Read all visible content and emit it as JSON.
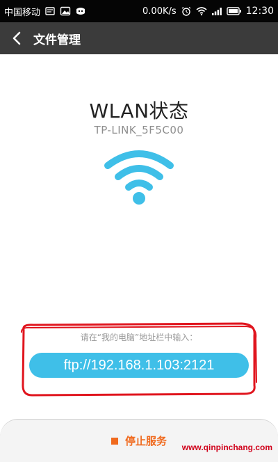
{
  "status_bar": {
    "carrier": "中国移动",
    "speed": "0.00K/s",
    "time": "12:30"
  },
  "header": {
    "title": "文件管理"
  },
  "main": {
    "wlan_title": "WLAN状态",
    "ssid": "TP-LINK_5F5C00",
    "hint": "请在“我的电脑”地址栏中输入：",
    "ftp_address": "ftp://192.168.1.103:2121"
  },
  "footer": {
    "stop_label": "停止服务"
  },
  "watermark": "www.qinpinchang.com",
  "colors": {
    "accent_blue": "#3fbfe8",
    "stop_orange": "#f06a1e",
    "header_bg": "#3b3b3b",
    "annotation_red": "#e0151e"
  },
  "icons": {
    "back": "chevron-left-icon",
    "wifi": "wifi-icon"
  }
}
